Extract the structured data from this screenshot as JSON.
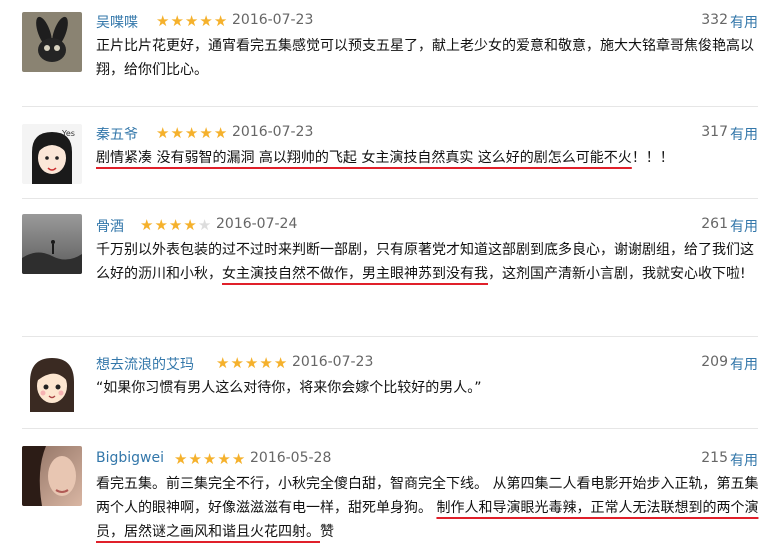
{
  "reviews": [
    {
      "author": "吴喋喋",
      "rating": 5,
      "date": "2016-07-23",
      "votes": "332",
      "useful_label": "有用",
      "text": "正片比片花更好，通宵看完五集感觉可以预支五星了，献上老少女的爱意和敬意，施大大铭章哥焦俊艳高以翔，给你们比心。"
    },
    {
      "author": "秦五爷",
      "rating": 5,
      "date": "2016-07-23",
      "votes": "317",
      "useful_label": "有用",
      "text_highlight": "剧情紧凑 没有弱智的漏洞 高以翔帅的飞起 女主演技自然真实 这么好的剧怎么可能不火",
      "text_after": "！！！"
    },
    {
      "author": "骨酒",
      "rating": 4,
      "date": "2016-07-24",
      "votes": "261",
      "useful_label": "有用",
      "text_before": "千万别以外表包装的过不过时来判断一部剧，只有原著党才知道这部剧到底多良心，谢谢剧组，给了我们这么好的沥川和小秋，",
      "text_highlight": "女主演技自然不做作，男主眼神苏到没有我",
      "text_after": "，这剂国产清新小言剧，我就安心收下啦!"
    },
    {
      "author": "想去流浪的艾玛",
      "rating": 5,
      "date": "2016-07-23",
      "votes": "209",
      "useful_label": "有用",
      "text": "“如果你习惯有男人这么对待你，将来你会嫁个比较好的男人。”"
    },
    {
      "author": "Bigbigwei",
      "rating": 5,
      "date": "2016-05-28",
      "votes": "215",
      "useful_label": "有用",
      "text_before": "看完五集。前三集完全不行，小秋完全傻白甜，智商完全下线。 从第四集二人看电影开始步入正轨，第五集两个人的眼神啊，好像滋滋滋有电一样，甜死单身狗。 ",
      "text_highlight": "制作人和导演眼光毒辣，正常人无法联想到的两个演员，居然谜之画风和谐且火花四射。",
      "text_after": "赞"
    }
  ],
  "colors": {
    "author": "#3377aa",
    "star": "#f5b12c",
    "highlight_underline": "#e0202a"
  },
  "icons": {
    "avatar_1": "rabbit-mask-avatar",
    "avatar_2": "cartoon-girl-avatar",
    "avatar_3": "grayscale-landscape-avatar",
    "avatar_4": "cartoon-girl-avatar",
    "avatar_5": "face-photo-avatar",
    "rating": "star-icon"
  }
}
